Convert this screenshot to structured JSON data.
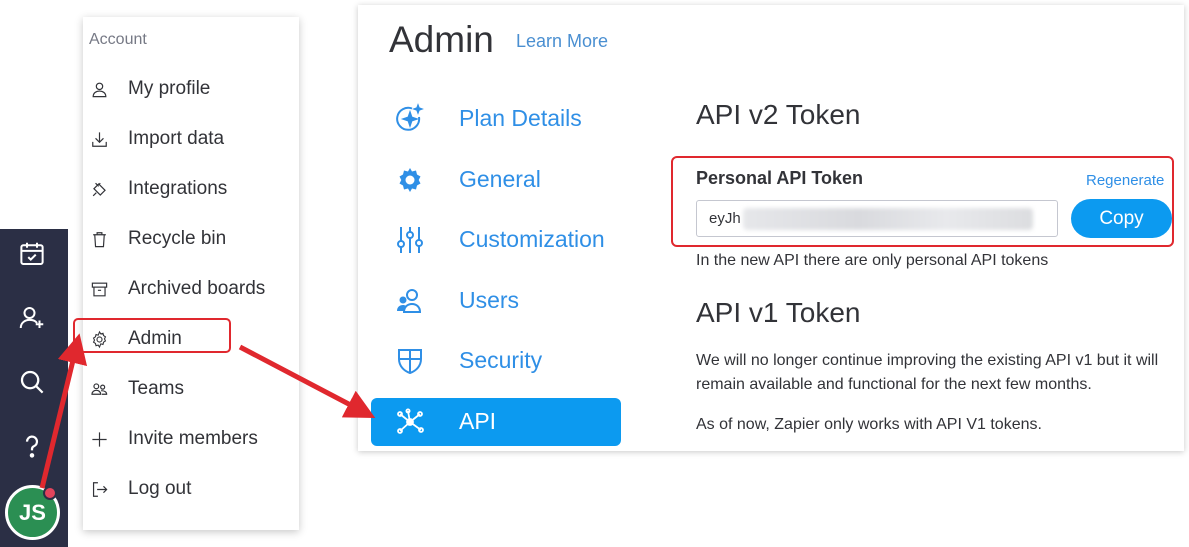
{
  "rail": {
    "icons": [
      "calendar-check-icon",
      "add-user-icon",
      "search-icon",
      "help-icon"
    ],
    "avatar_initials": "JS"
  },
  "menu": {
    "heading": "Account",
    "items": [
      {
        "label": "My profile",
        "icon": "person-icon"
      },
      {
        "label": "Import data",
        "icon": "download-icon"
      },
      {
        "label": "Integrations",
        "icon": "plug-icon"
      },
      {
        "label": "Recycle bin",
        "icon": "trash-icon"
      },
      {
        "label": "Archived boards",
        "icon": "archive-icon"
      },
      {
        "label": "Admin",
        "icon": "gear-icon"
      },
      {
        "label": "Teams",
        "icon": "team-icon"
      },
      {
        "label": "Invite members",
        "icon": "plus-icon"
      },
      {
        "label": "Log out",
        "icon": "logout-icon"
      }
    ]
  },
  "admin": {
    "title": "Admin",
    "learn_more": "Learn More",
    "nav": [
      {
        "label": "Plan Details",
        "icon": "sparkle-icon"
      },
      {
        "label": "General",
        "icon": "gear-icon"
      },
      {
        "label": "Customization",
        "icon": "sliders-icon"
      },
      {
        "label": "Users",
        "icon": "users-icon"
      },
      {
        "label": "Security",
        "icon": "shield-icon"
      },
      {
        "label": "API",
        "icon": "network-icon",
        "active": true
      }
    ],
    "v2": {
      "title": "API v2 Token",
      "token_label": "Personal API Token",
      "regenerate": "Regenerate",
      "token_value": "eyJh",
      "copy": "Copy",
      "hint": "In the new API there are only personal API tokens"
    },
    "v1": {
      "title": "API v1 Token",
      "paragraph1": "We will no longer continue improving the existing API v1 but it will remain available and functional for the next few months.",
      "paragraph2": "As of now, Zapier only works with API V1 tokens."
    }
  },
  "colors": {
    "accent": "#0c9af0",
    "link": "#2f8fe6",
    "annotation": "#e0282e",
    "rail": "#2b2f45",
    "avatar": "#2b8f53"
  }
}
